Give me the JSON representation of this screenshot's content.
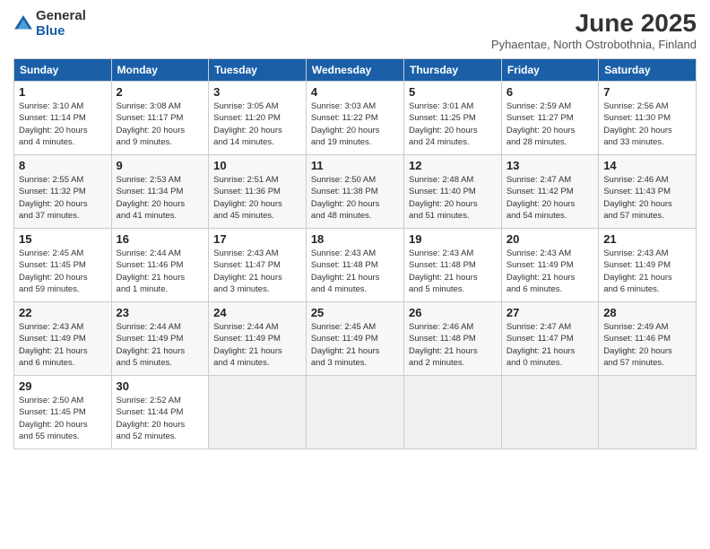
{
  "logo": {
    "general": "General",
    "blue": "Blue"
  },
  "title": "June 2025",
  "subtitle": "Pyhaentae, North Ostrobothnia, Finland",
  "days_header": [
    "Sunday",
    "Monday",
    "Tuesday",
    "Wednesday",
    "Thursday",
    "Friday",
    "Saturday"
  ],
  "weeks": [
    [
      {
        "day": "1",
        "info": "Sunrise: 3:10 AM\nSunset: 11:14 PM\nDaylight: 20 hours\nand 4 minutes."
      },
      {
        "day": "2",
        "info": "Sunrise: 3:08 AM\nSunset: 11:17 PM\nDaylight: 20 hours\nand 9 minutes."
      },
      {
        "day": "3",
        "info": "Sunrise: 3:05 AM\nSunset: 11:20 PM\nDaylight: 20 hours\nand 14 minutes."
      },
      {
        "day": "4",
        "info": "Sunrise: 3:03 AM\nSunset: 11:22 PM\nDaylight: 20 hours\nand 19 minutes."
      },
      {
        "day": "5",
        "info": "Sunrise: 3:01 AM\nSunset: 11:25 PM\nDaylight: 20 hours\nand 24 minutes."
      },
      {
        "day": "6",
        "info": "Sunrise: 2:59 AM\nSunset: 11:27 PM\nDaylight: 20 hours\nand 28 minutes."
      },
      {
        "day": "7",
        "info": "Sunrise: 2:56 AM\nSunset: 11:30 PM\nDaylight: 20 hours\nand 33 minutes."
      }
    ],
    [
      {
        "day": "8",
        "info": "Sunrise: 2:55 AM\nSunset: 11:32 PM\nDaylight: 20 hours\nand 37 minutes."
      },
      {
        "day": "9",
        "info": "Sunrise: 2:53 AM\nSunset: 11:34 PM\nDaylight: 20 hours\nand 41 minutes."
      },
      {
        "day": "10",
        "info": "Sunrise: 2:51 AM\nSunset: 11:36 PM\nDaylight: 20 hours\nand 45 minutes."
      },
      {
        "day": "11",
        "info": "Sunrise: 2:50 AM\nSunset: 11:38 PM\nDaylight: 20 hours\nand 48 minutes."
      },
      {
        "day": "12",
        "info": "Sunrise: 2:48 AM\nSunset: 11:40 PM\nDaylight: 20 hours\nand 51 minutes."
      },
      {
        "day": "13",
        "info": "Sunrise: 2:47 AM\nSunset: 11:42 PM\nDaylight: 20 hours\nand 54 minutes."
      },
      {
        "day": "14",
        "info": "Sunrise: 2:46 AM\nSunset: 11:43 PM\nDaylight: 20 hours\nand 57 minutes."
      }
    ],
    [
      {
        "day": "15",
        "info": "Sunrise: 2:45 AM\nSunset: 11:45 PM\nDaylight: 20 hours\nand 59 minutes."
      },
      {
        "day": "16",
        "info": "Sunrise: 2:44 AM\nSunset: 11:46 PM\nDaylight: 21 hours\nand 1 minute."
      },
      {
        "day": "17",
        "info": "Sunrise: 2:43 AM\nSunset: 11:47 PM\nDaylight: 21 hours\nand 3 minutes."
      },
      {
        "day": "18",
        "info": "Sunrise: 2:43 AM\nSunset: 11:48 PM\nDaylight: 21 hours\nand 4 minutes."
      },
      {
        "day": "19",
        "info": "Sunrise: 2:43 AM\nSunset: 11:48 PM\nDaylight: 21 hours\nand 5 minutes."
      },
      {
        "day": "20",
        "info": "Sunrise: 2:43 AM\nSunset: 11:49 PM\nDaylight: 21 hours\nand 6 minutes."
      },
      {
        "day": "21",
        "info": "Sunrise: 2:43 AM\nSunset: 11:49 PM\nDaylight: 21 hours\nand 6 minutes."
      }
    ],
    [
      {
        "day": "22",
        "info": "Sunrise: 2:43 AM\nSunset: 11:49 PM\nDaylight: 21 hours\nand 6 minutes."
      },
      {
        "day": "23",
        "info": "Sunrise: 2:44 AM\nSunset: 11:49 PM\nDaylight: 21 hours\nand 5 minutes."
      },
      {
        "day": "24",
        "info": "Sunrise: 2:44 AM\nSunset: 11:49 PM\nDaylight: 21 hours\nand 4 minutes."
      },
      {
        "day": "25",
        "info": "Sunrise: 2:45 AM\nSunset: 11:49 PM\nDaylight: 21 hours\nand 3 minutes."
      },
      {
        "day": "26",
        "info": "Sunrise: 2:46 AM\nSunset: 11:48 PM\nDaylight: 21 hours\nand 2 minutes."
      },
      {
        "day": "27",
        "info": "Sunrise: 2:47 AM\nSunset: 11:47 PM\nDaylight: 21 hours\nand 0 minutes."
      },
      {
        "day": "28",
        "info": "Sunrise: 2:49 AM\nSunset: 11:46 PM\nDaylight: 20 hours\nand 57 minutes."
      }
    ],
    [
      {
        "day": "29",
        "info": "Sunrise: 2:50 AM\nSunset: 11:45 PM\nDaylight: 20 hours\nand 55 minutes."
      },
      {
        "day": "30",
        "info": "Sunrise: 2:52 AM\nSunset: 11:44 PM\nDaylight: 20 hours\nand 52 minutes."
      },
      {
        "day": "",
        "info": ""
      },
      {
        "day": "",
        "info": ""
      },
      {
        "day": "",
        "info": ""
      },
      {
        "day": "",
        "info": ""
      },
      {
        "day": "",
        "info": ""
      }
    ]
  ]
}
